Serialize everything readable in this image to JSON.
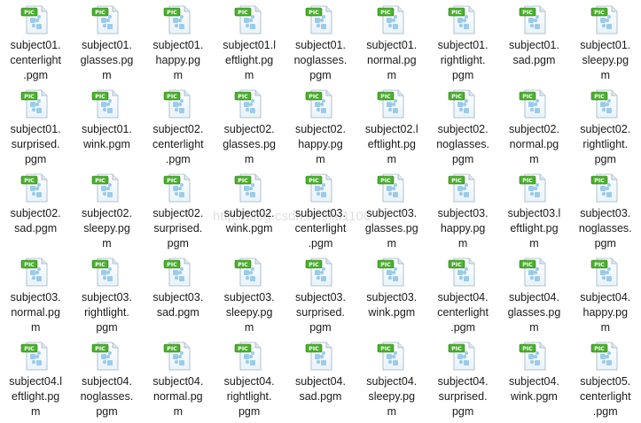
{
  "icon": {
    "name": "pgm-image-file-icon",
    "badge_text": "PIC",
    "badge_color": "#4caf2f",
    "page_color": "#e8f3fb",
    "puzzle_color": "#9ccbea"
  },
  "watermark_text": "http://blog.csdn.net/liu1100",
  "files": [
    {
      "line1": "subject01.",
      "line2": "centerlight",
      "line3": ".pgm"
    },
    {
      "line1": "subject01.",
      "line2": "glasses.pg",
      "line3": "m"
    },
    {
      "line1": "subject01.",
      "line2": "happy.pg",
      "line3": "m"
    },
    {
      "line1": "subject01.l",
      "line2": "eftlight.pg",
      "line3": "m"
    },
    {
      "line1": "subject01.",
      "line2": "noglasses.",
      "line3": "pgm"
    },
    {
      "line1": "subject01.",
      "line2": "normal.pg",
      "line3": "m"
    },
    {
      "line1": "subject01.",
      "line2": "rightlight.",
      "line3": "pgm"
    },
    {
      "line1": "subject01.",
      "line2": "sad.pgm",
      "line3": ""
    },
    {
      "line1": "subject01.",
      "line2": "sleepy.pg",
      "line3": "m"
    },
    {
      "line1": "subject01.",
      "line2": "surprised.",
      "line3": "pgm"
    },
    {
      "line1": "subject01.",
      "line2": "wink.pgm",
      "line3": ""
    },
    {
      "line1": "subject02.",
      "line2": "centerlight",
      "line3": ".pgm"
    },
    {
      "line1": "subject02.",
      "line2": "glasses.pg",
      "line3": "m"
    },
    {
      "line1": "subject02.",
      "line2": "happy.pg",
      "line3": "m"
    },
    {
      "line1": "subject02.l",
      "line2": "eftlight.pg",
      "line3": "m"
    },
    {
      "line1": "subject02.",
      "line2": "noglasses.",
      "line3": "pgm"
    },
    {
      "line1": "subject02.",
      "line2": "normal.pg",
      "line3": "m"
    },
    {
      "line1": "subject02.",
      "line2": "rightlight.",
      "line3": "pgm"
    },
    {
      "line1": "subject02.",
      "line2": "sad.pgm",
      "line3": ""
    },
    {
      "line1": "subject02.",
      "line2": "sleepy.pg",
      "line3": "m"
    },
    {
      "line1": "subject02.",
      "line2": "surprised.",
      "line3": "pgm"
    },
    {
      "line1": "subject02.",
      "line2": "wink.pgm",
      "line3": ""
    },
    {
      "line1": "subject03.",
      "line2": "centerlight",
      "line3": ".pgm"
    },
    {
      "line1": "subject03.",
      "line2": "glasses.pg",
      "line3": "m"
    },
    {
      "line1": "subject03.",
      "line2": "happy.pg",
      "line3": "m"
    },
    {
      "line1": "subject03.l",
      "line2": "eftlight.pg",
      "line3": "m"
    },
    {
      "line1": "subject03.",
      "line2": "noglasses.",
      "line3": "pgm"
    },
    {
      "line1": "subject03.",
      "line2": "normal.pg",
      "line3": "m"
    },
    {
      "line1": "subject03.",
      "line2": "rightlight.",
      "line3": "pgm"
    },
    {
      "line1": "subject03.",
      "line2": "sad.pgm",
      "line3": ""
    },
    {
      "line1": "subject03.",
      "line2": "sleepy.pg",
      "line3": "m"
    },
    {
      "line1": "subject03.",
      "line2": "surprised.",
      "line3": "pgm"
    },
    {
      "line1": "subject03.",
      "line2": "wink.pgm",
      "line3": ""
    },
    {
      "line1": "subject04.",
      "line2": "centerlight",
      "line3": ".pgm"
    },
    {
      "line1": "subject04.",
      "line2": "glasses.pg",
      "line3": "m"
    },
    {
      "line1": "subject04.",
      "line2": "happy.pg",
      "line3": "m"
    },
    {
      "line1": "subject04.l",
      "line2": "eftlight.pg",
      "line3": "m"
    },
    {
      "line1": "subject04.",
      "line2": "noglasses.",
      "line3": "pgm"
    },
    {
      "line1": "subject04.",
      "line2": "normal.pg",
      "line3": "m"
    },
    {
      "line1": "subject04.",
      "line2": "rightlight.",
      "line3": "pgm"
    },
    {
      "line1": "subject04.",
      "line2": "sad.pgm",
      "line3": ""
    },
    {
      "line1": "subject04.",
      "line2": "sleepy.pg",
      "line3": "m"
    },
    {
      "line1": "subject04.",
      "line2": "surprised.",
      "line3": "pgm"
    },
    {
      "line1": "subject04.",
      "line2": "wink.pgm",
      "line3": ""
    },
    {
      "line1": "subject05.",
      "line2": "centerlight",
      "line3": ".pgm"
    }
  ]
}
